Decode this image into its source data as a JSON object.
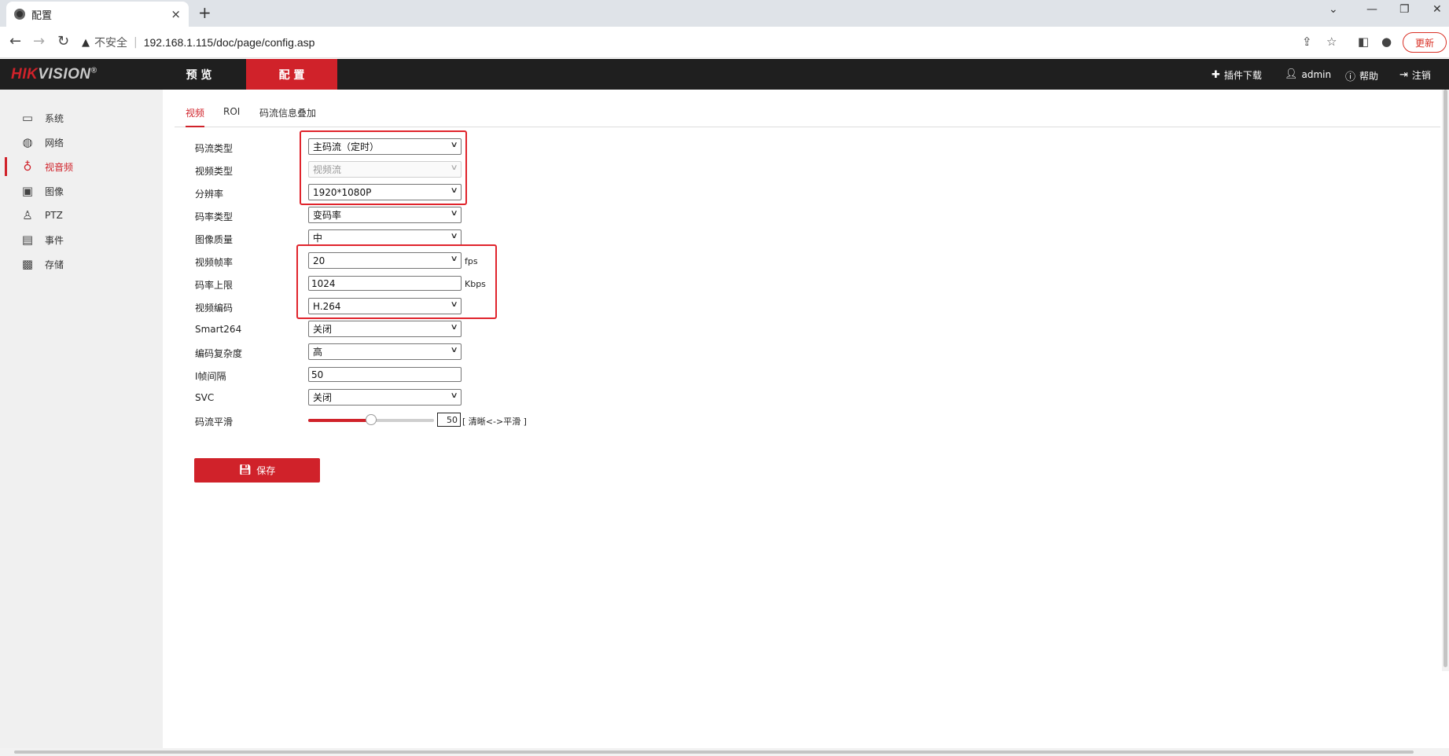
{
  "browser": {
    "tab_title": "配置",
    "tab_close": "×",
    "new_tab": "+",
    "insecure_label": "不安全",
    "separator": "|",
    "url": "192.168.1.115/doc/page/config.asp",
    "update_label": "更新"
  },
  "header": {
    "logo_main": "HIK",
    "logo_accent": "VISION",
    "logo_mark": "®",
    "nav": [
      {
        "label": "预 览"
      },
      {
        "label": "配 置"
      }
    ],
    "right": {
      "plugin_label": "插件下载",
      "user_label": "admin",
      "help_label": "帮助",
      "logout_label": "注销"
    }
  },
  "sidebar": {
    "items": [
      {
        "label": "系统",
        "icon": "system-icon"
      },
      {
        "label": "网络",
        "icon": "network-icon"
      },
      {
        "label": "视音频",
        "icon": "audio-video-icon"
      },
      {
        "label": "图像",
        "icon": "image-icon"
      },
      {
        "label": "PTZ",
        "icon": "ptz-icon"
      },
      {
        "label": "事件",
        "icon": "event-icon"
      },
      {
        "label": "存储",
        "icon": "storage-icon"
      }
    ],
    "active_index": 2
  },
  "subtabs": [
    {
      "label": "视频"
    },
    {
      "label": "ROI"
    },
    {
      "label": "码流信息叠加"
    }
  ],
  "form": {
    "stream_type": {
      "label": "码流类型",
      "value": "主码流（定时）"
    },
    "video_type": {
      "label": "视频类型",
      "value": "视频流"
    },
    "resolution": {
      "label": "分辨率",
      "value": "1920*1080P"
    },
    "bitrate_type": {
      "label": "码率类型",
      "value": "变码率"
    },
    "image_quality": {
      "label": "图像质量",
      "value": "中"
    },
    "frame_rate": {
      "label": "视频帧率",
      "value": "20",
      "unit": "fps"
    },
    "bitrate_limit": {
      "label": "码率上限",
      "value": "1024",
      "unit": "Kbps"
    },
    "video_encoding": {
      "label": "视频编码",
      "value": "H.264"
    },
    "smart264": {
      "label": "Smart264",
      "value": "关闭"
    },
    "encoding_complexity": {
      "label": "编码复杂度",
      "value": "高"
    },
    "i_frame_interval": {
      "label": "I帧间隔",
      "value": "50"
    },
    "svc": {
      "label": "SVC",
      "value": "关闭"
    },
    "stream_smoothing": {
      "label": "码流平滑",
      "value": "50",
      "hint": "[ 清晰<->平滑 ]",
      "level_percent": 50
    }
  },
  "save_label": "保存"
}
